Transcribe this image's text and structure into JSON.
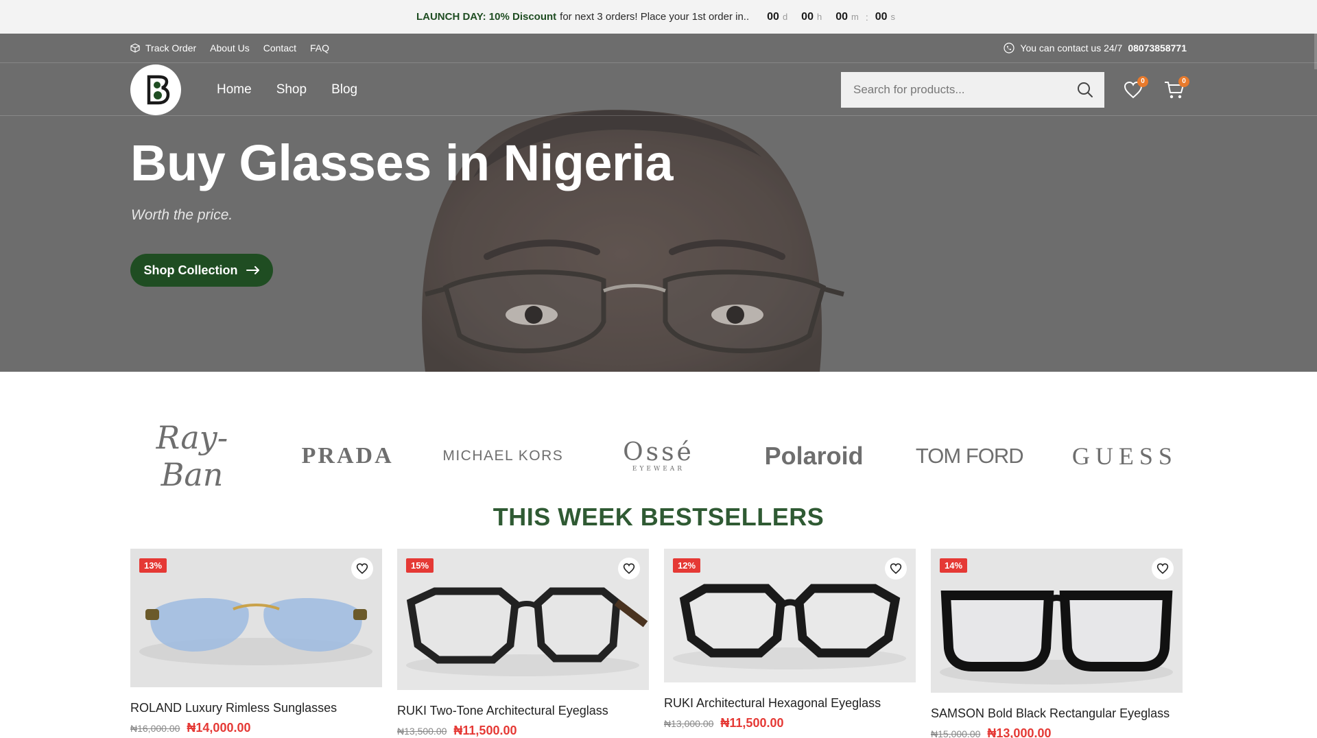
{
  "announcement": {
    "lead": "LAUNCH DAY: 10% Discount",
    "rest": "for next 3 orders! Place your 1st order in..",
    "countdown": [
      {
        "value": "00",
        "unit": "d"
      },
      {
        "value": "00",
        "unit": "h"
      },
      {
        "value": "00",
        "unit": "m"
      },
      {
        "value": "00",
        "unit": "s"
      }
    ],
    "separator": ":"
  },
  "topbar": {
    "links": [
      "Track Order",
      "About Us",
      "Contact",
      "FAQ"
    ],
    "contact_text": "You can contact us 24/7",
    "phone": "08073858771"
  },
  "nav": {
    "links": [
      "Home",
      "Shop",
      "Blog"
    ],
    "search_placeholder": "Search for products...",
    "wishlist_count": "0",
    "cart_count": "0"
  },
  "hero": {
    "title": "Buy Glasses in Nigeria",
    "subtitle": "Worth the price.",
    "button_label": "Shop Collection"
  },
  "brands": [
    "Ray-Ban",
    "PRADA",
    "MICHAEL KORS",
    "Ossé",
    "Polaroid",
    "TOM FORD",
    "GUESS"
  ],
  "brand_osse_sub": "EYEWEAR",
  "section_title": "THIS WEEK BESTSELLERS",
  "products": [
    {
      "badge": "13%",
      "name": "ROLAND Luxury Rimless Sunglasses",
      "old_price": "₦16,000.00",
      "new_price": "₦14,000.00"
    },
    {
      "badge": "15%",
      "name": "RUKI Two-Tone Architectural Eyeglass",
      "old_price": "₦13,500.00",
      "new_price": "₦11,500.00"
    },
    {
      "badge": "12%",
      "name": "RUKI Architectural Hexagonal Eyeglass",
      "old_price": "₦13,000.00",
      "new_price": "₦11,500.00"
    },
    {
      "badge": "14%",
      "name": "SAMSON Bold Black Rectangular Eyeglass",
      "old_price": "₦15,000.00",
      "new_price": "₦13,000.00"
    }
  ],
  "colors": {
    "brand_green": "#1f4d22",
    "title_green": "#2f5a33",
    "sale_red": "#e53935",
    "badge_orange": "#e87a2c"
  }
}
